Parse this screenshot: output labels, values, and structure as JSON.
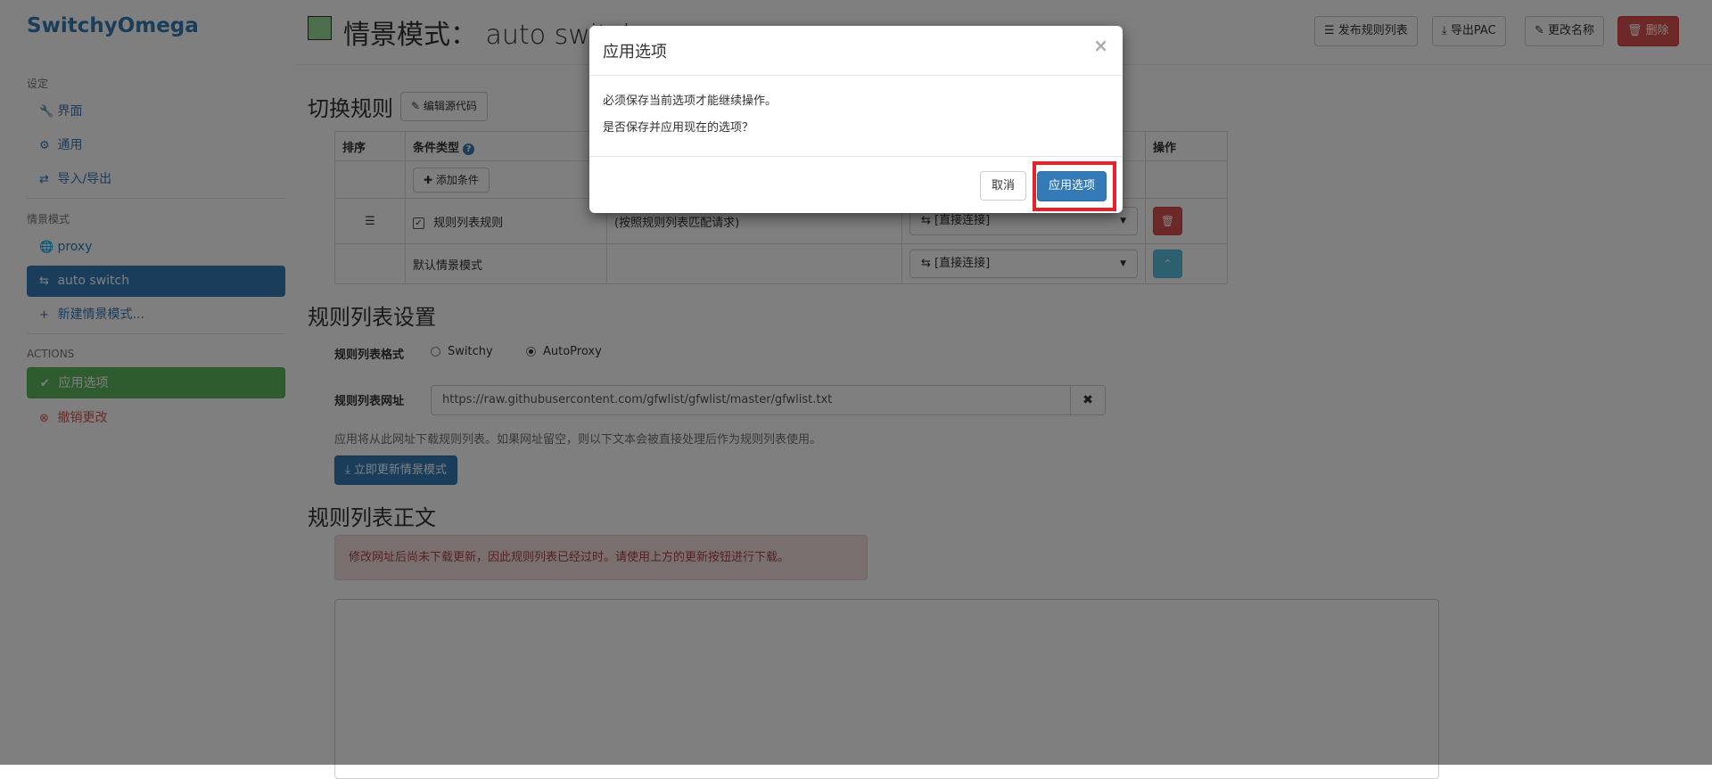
{
  "sidebar": {
    "brand": "SwitchyOmega",
    "settings_header": "设定",
    "settings_items": [
      {
        "label": "界面",
        "icon": "wrench-icon",
        "glyph": "🔧"
      },
      {
        "label": "通用",
        "icon": "gear-icon",
        "glyph": "⚙"
      },
      {
        "label": "导入/导出",
        "icon": "import-export-icon",
        "glyph": "⇄"
      }
    ],
    "profiles_header": "情景模式",
    "profiles": [
      {
        "label": "proxy",
        "icon": "globe-icon",
        "glyph": "🌐"
      },
      {
        "label": "auto switch",
        "icon": "switch-icon",
        "glyph": "⇆"
      }
    ],
    "new_profile": {
      "label": "新建情景模式...",
      "glyph": "+"
    },
    "actions_header": "ACTIONS",
    "apply": {
      "label": "应用选项",
      "glyph": "✔"
    },
    "discard": {
      "label": "撤销更改",
      "glyph": "⊗"
    }
  },
  "header": {
    "title": "情景模式： auto switch",
    "profile_color": "#99dd99",
    "buttons": {
      "publish": "发布规则列表",
      "export_pac": "导出PAC",
      "rename": "更改名称",
      "delete": "删除"
    }
  },
  "rules_section": {
    "title": "切换规则",
    "edit_source": "编辑源代码",
    "columns": {
      "sort": "排序",
      "condition_type": "条件类型",
      "actions": "操作"
    },
    "add_condition": "添加条件",
    "rows": [
      {
        "condition": "规则列表规则",
        "details": "(按照规则列表匹配请求)",
        "profile": "[直接连接]"
      }
    ],
    "default_row": {
      "label": "默认情景模式",
      "profile": "[直接连接]"
    }
  },
  "rulelist_settings": {
    "title": "规则列表设置",
    "format_label": "规则列表格式",
    "formats": [
      "Switchy",
      "AutoProxy"
    ],
    "selected_format": "AutoProxy",
    "url_label": "规则列表网址",
    "url_value": "https://raw.githubusercontent.com/gfwlist/gfwlist/master/gfwlist.txt",
    "help": "应用将从此网址下载规则列表。如果网址留空，则以下文本会被直接处理后作为规则列表使用。",
    "update_button": "立即更新情景模式"
  },
  "rulelist_text": {
    "title": "规则列表正文",
    "alert": "修改网址后尚未下载更新，因此规则列表已经过时。请使用上方的更新按钮进行下载。"
  },
  "modal": {
    "title": "应用选项",
    "line1": "必须保存当前选项才能继续操作。",
    "line2": "是否保存并应用现在的选项？",
    "cancel": "取消",
    "apply": "应用选项",
    "highlight_color": "#e8202a"
  }
}
